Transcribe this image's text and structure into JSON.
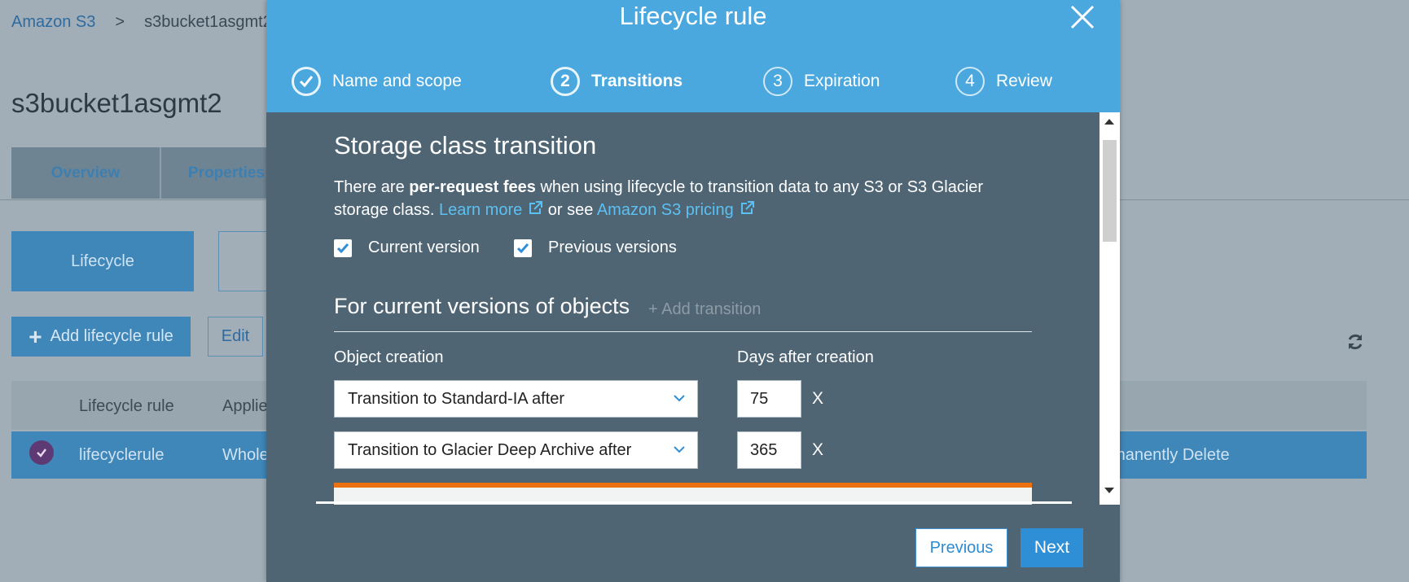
{
  "breadcrumb": {
    "root": "Amazon S3",
    "separator": ">",
    "current": "s3bucket1asgmt2"
  },
  "bucket_title": "s3bucket1asgmt2",
  "tabs": [
    {
      "label": "Overview"
    },
    {
      "label": "Properties"
    }
  ],
  "lifecycle_button": "Lifecycle",
  "add_rule_button": "Add lifecycle rule",
  "edit_button": "Edit",
  "table": {
    "headers": {
      "rule": "Lifecycle rule",
      "applied": "Applied to"
    },
    "row": {
      "rule": "lifecyclerule",
      "applied": "Whole bucket",
      "action": "Permanently Delete"
    }
  },
  "modal": {
    "title": "Lifecycle rule",
    "steps": [
      {
        "number": "1",
        "label": "Name and scope",
        "state": "done"
      },
      {
        "number": "2",
        "label": "Transitions",
        "state": "active"
      },
      {
        "number": "3",
        "label": "Expiration",
        "state": "pending"
      },
      {
        "number": "4",
        "label": "Review",
        "state": "pending"
      }
    ],
    "section_title": "Storage class transition",
    "desc": {
      "p1": "There are ",
      "bold": "per-request fees",
      "p2": " when using lifecycle to transition data to any S3 or S3 Glacier storage class. ",
      "learn_more": "Learn more",
      "p3": " or see ",
      "pricing": "Amazon S3 pricing"
    },
    "checkboxes": [
      {
        "label": "Current version",
        "checked": true
      },
      {
        "label": "Previous versions",
        "checked": true
      }
    ],
    "current_versions_title": "For current versions of objects",
    "add_transition": "+ Add transition",
    "col_object_creation": "Object creation",
    "col_days": "Days after creation",
    "transitions": [
      {
        "type": "Transition to Standard-IA after",
        "days": "75",
        "remove": "X"
      },
      {
        "type": "Transition to Glacier Deep Archive after",
        "days": "365",
        "remove": "X"
      }
    ],
    "buttons": {
      "previous": "Previous",
      "next": "Next"
    }
  },
  "colors": {
    "header": "#4aa8de",
    "body": "#4f6574",
    "link": "#5cc0f2",
    "warning": "#ec7211",
    "primary": "#2f8fd6"
  }
}
